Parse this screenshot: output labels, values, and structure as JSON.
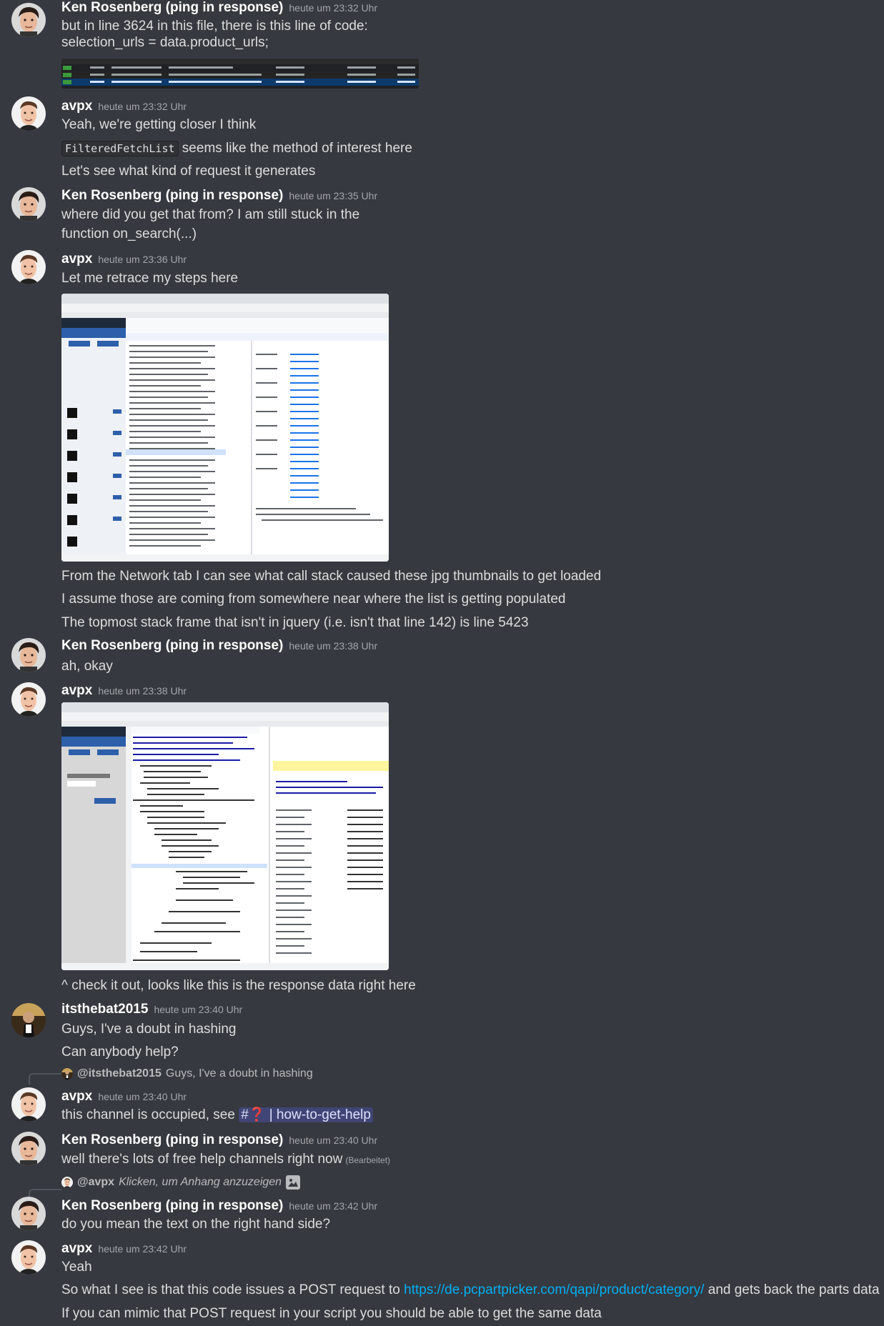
{
  "colors": {
    "background": "#36393f",
    "username": "#ffffff",
    "timestamp": "#a3a6aa",
    "text": "#dcddde",
    "link": "#00aff4",
    "mention_bg": "#5865f24d"
  },
  "messages": [
    {
      "author": "Ken Rosenberg (ping in response)",
      "time": "heute um 23:32 Uhr",
      "lines": [
        "but in line 3624 in this file, there is this line of code:",
        "selection_urls = data.product_urls;"
      ],
      "attachment": "network-table-screenshot"
    },
    {
      "author": "avpx",
      "time": "heute um 23:32 Uhr",
      "lines": [
        "Yeah, we're getting closer I think"
      ],
      "code_line": {
        "code": "FilteredFetchList",
        "rest": " seems like the method of interest here"
      },
      "after": [
        "Let's see what kind of request it generates"
      ]
    },
    {
      "author": "Ken Rosenberg (ping in response)",
      "time": "heute um 23:35 Uhr",
      "lines": [
        "where did you get that from? I am still stuck in the",
        "function on_search(...)"
      ]
    },
    {
      "author": "avpx",
      "time": "heute um 23:36 Uhr",
      "lines": [
        "Let me retrace my steps here"
      ],
      "attachment": "devtools-network-screenshot",
      "after": [
        "From the Network tab I can see what call stack caused these jpg thumbnails to get loaded",
        "I assume those are coming from somewhere near where the list is getting populated",
        "The topmost stack frame that isn't in jquery (i.e. isn't that line 142) is line 5423"
      ]
    },
    {
      "author": "Ken Rosenberg (ping in response)",
      "time": "heute um 23:38 Uhr",
      "lines": [
        "ah, okay"
      ]
    },
    {
      "author": "avpx",
      "time": "heute um 23:38 Uhr",
      "attachment": "devtools-debugger-screenshot",
      "after": [
        "^ check it out, looks like this is the response data right here"
      ]
    },
    {
      "author": "itsthebat2015",
      "time": "heute um 23:40 Uhr",
      "lines": [
        "Guys, I've a doubt in hashing",
        "Can anybody help?"
      ]
    },
    {
      "reply": {
        "user": "@itsthebat2015",
        "text": "Guys, I've a doubt in hashing"
      },
      "author": "avpx",
      "time": "heute um 23:40 Uhr",
      "text": "this channel is occupied, see ",
      "mention": "#❓ | how-to-get-help"
    },
    {
      "author": "Ken Rosenberg (ping in response)",
      "time": "heute um 23:40 Uhr",
      "text": "well there's lots of free help channels right now",
      "edited": "(Bearbeitet)"
    },
    {
      "reply": {
        "user": "@avpx",
        "text": "Klicken, um Anhang anzuzeigen"
      },
      "author": "Ken Rosenberg (ping in response)",
      "time": "heute um 23:42 Uhr",
      "lines": [
        "do you mean the text on the right hand side?"
      ]
    },
    {
      "author": "avpx",
      "time": "heute um 23:42 Uhr",
      "lines": [
        "Yeah"
      ],
      "link_line": {
        "before": "So what I see is that this code issues a POST request to ",
        "url": "https://de.pcpartpicker.com/qapi/product/category/",
        "after": " and gets back the parts data"
      },
      "last": "If you can mimic that POST request in your script you should be able to get the same data"
    }
  ]
}
